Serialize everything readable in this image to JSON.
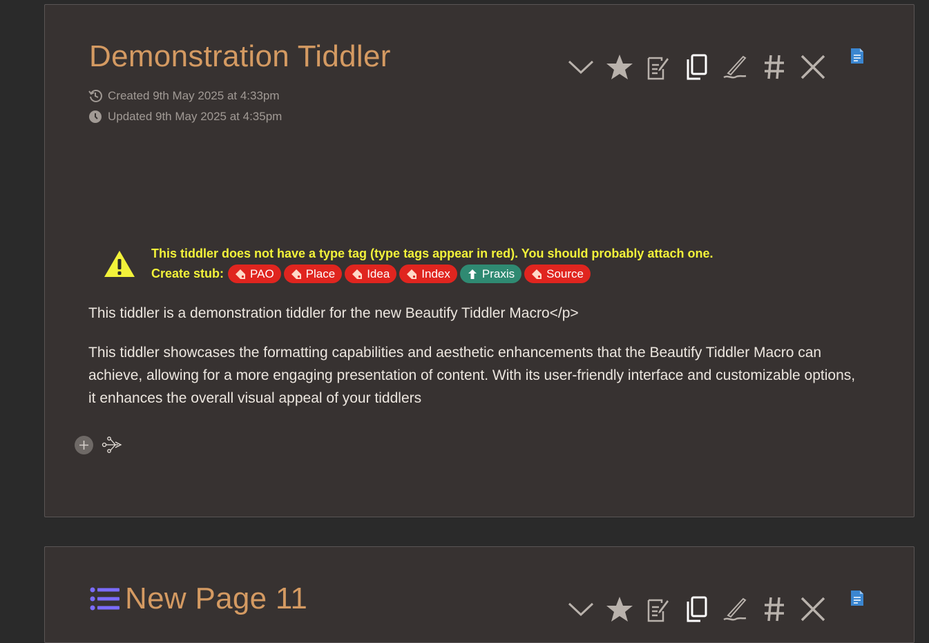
{
  "tiddler1": {
    "title": "Demonstration Tiddler",
    "created": "Created 9th May 2025 at 4:33pm",
    "updated": "Updated 9th May 2025 at 4:35pm",
    "toolbar": {
      "icons": [
        "chevron-down-icon",
        "star-icon",
        "export-icon",
        "copy-icon",
        "edit-icon",
        "hash-icon",
        "close-icon",
        "document-icon"
      ]
    },
    "warning": {
      "message": "This tiddler does not have a type tag (type tags appear in red). You should probably attach one.",
      "stub_label": "Create stub:",
      "tags": [
        {
          "label": "PAO",
          "color": "#e0251f"
        },
        {
          "label": "Place",
          "color": "#e0251f"
        },
        {
          "label": "Idea",
          "color": "#e0251f"
        },
        {
          "label": "Index",
          "color": "#e0251f"
        },
        {
          "label": "Praxis",
          "color": "#2f8a72"
        },
        {
          "label": "Source",
          "color": "#e0251f"
        }
      ]
    },
    "body": {
      "p1": "This tiddler is a demonstration tiddler for the new Beautify Tiddler Macro</p>",
      "p2": "This tiddler showcases the formatting capabilities and aesthetic enhancements that the Beautify Tiddler Macro can achieve, allowing for a more engaging presentation of content. With its user-friendly interface and customizable options, it enhances the overall visual appeal of your tiddlers"
    }
  },
  "tiddler2": {
    "title": "New Page 11"
  },
  "colors": {
    "title": "#d49a62",
    "warning_text": "#f2f23a",
    "tag_red": "#e0251f",
    "tag_teal": "#2f8a72",
    "panel_bg": "#373231",
    "page_bg": "#2a2a2a"
  }
}
